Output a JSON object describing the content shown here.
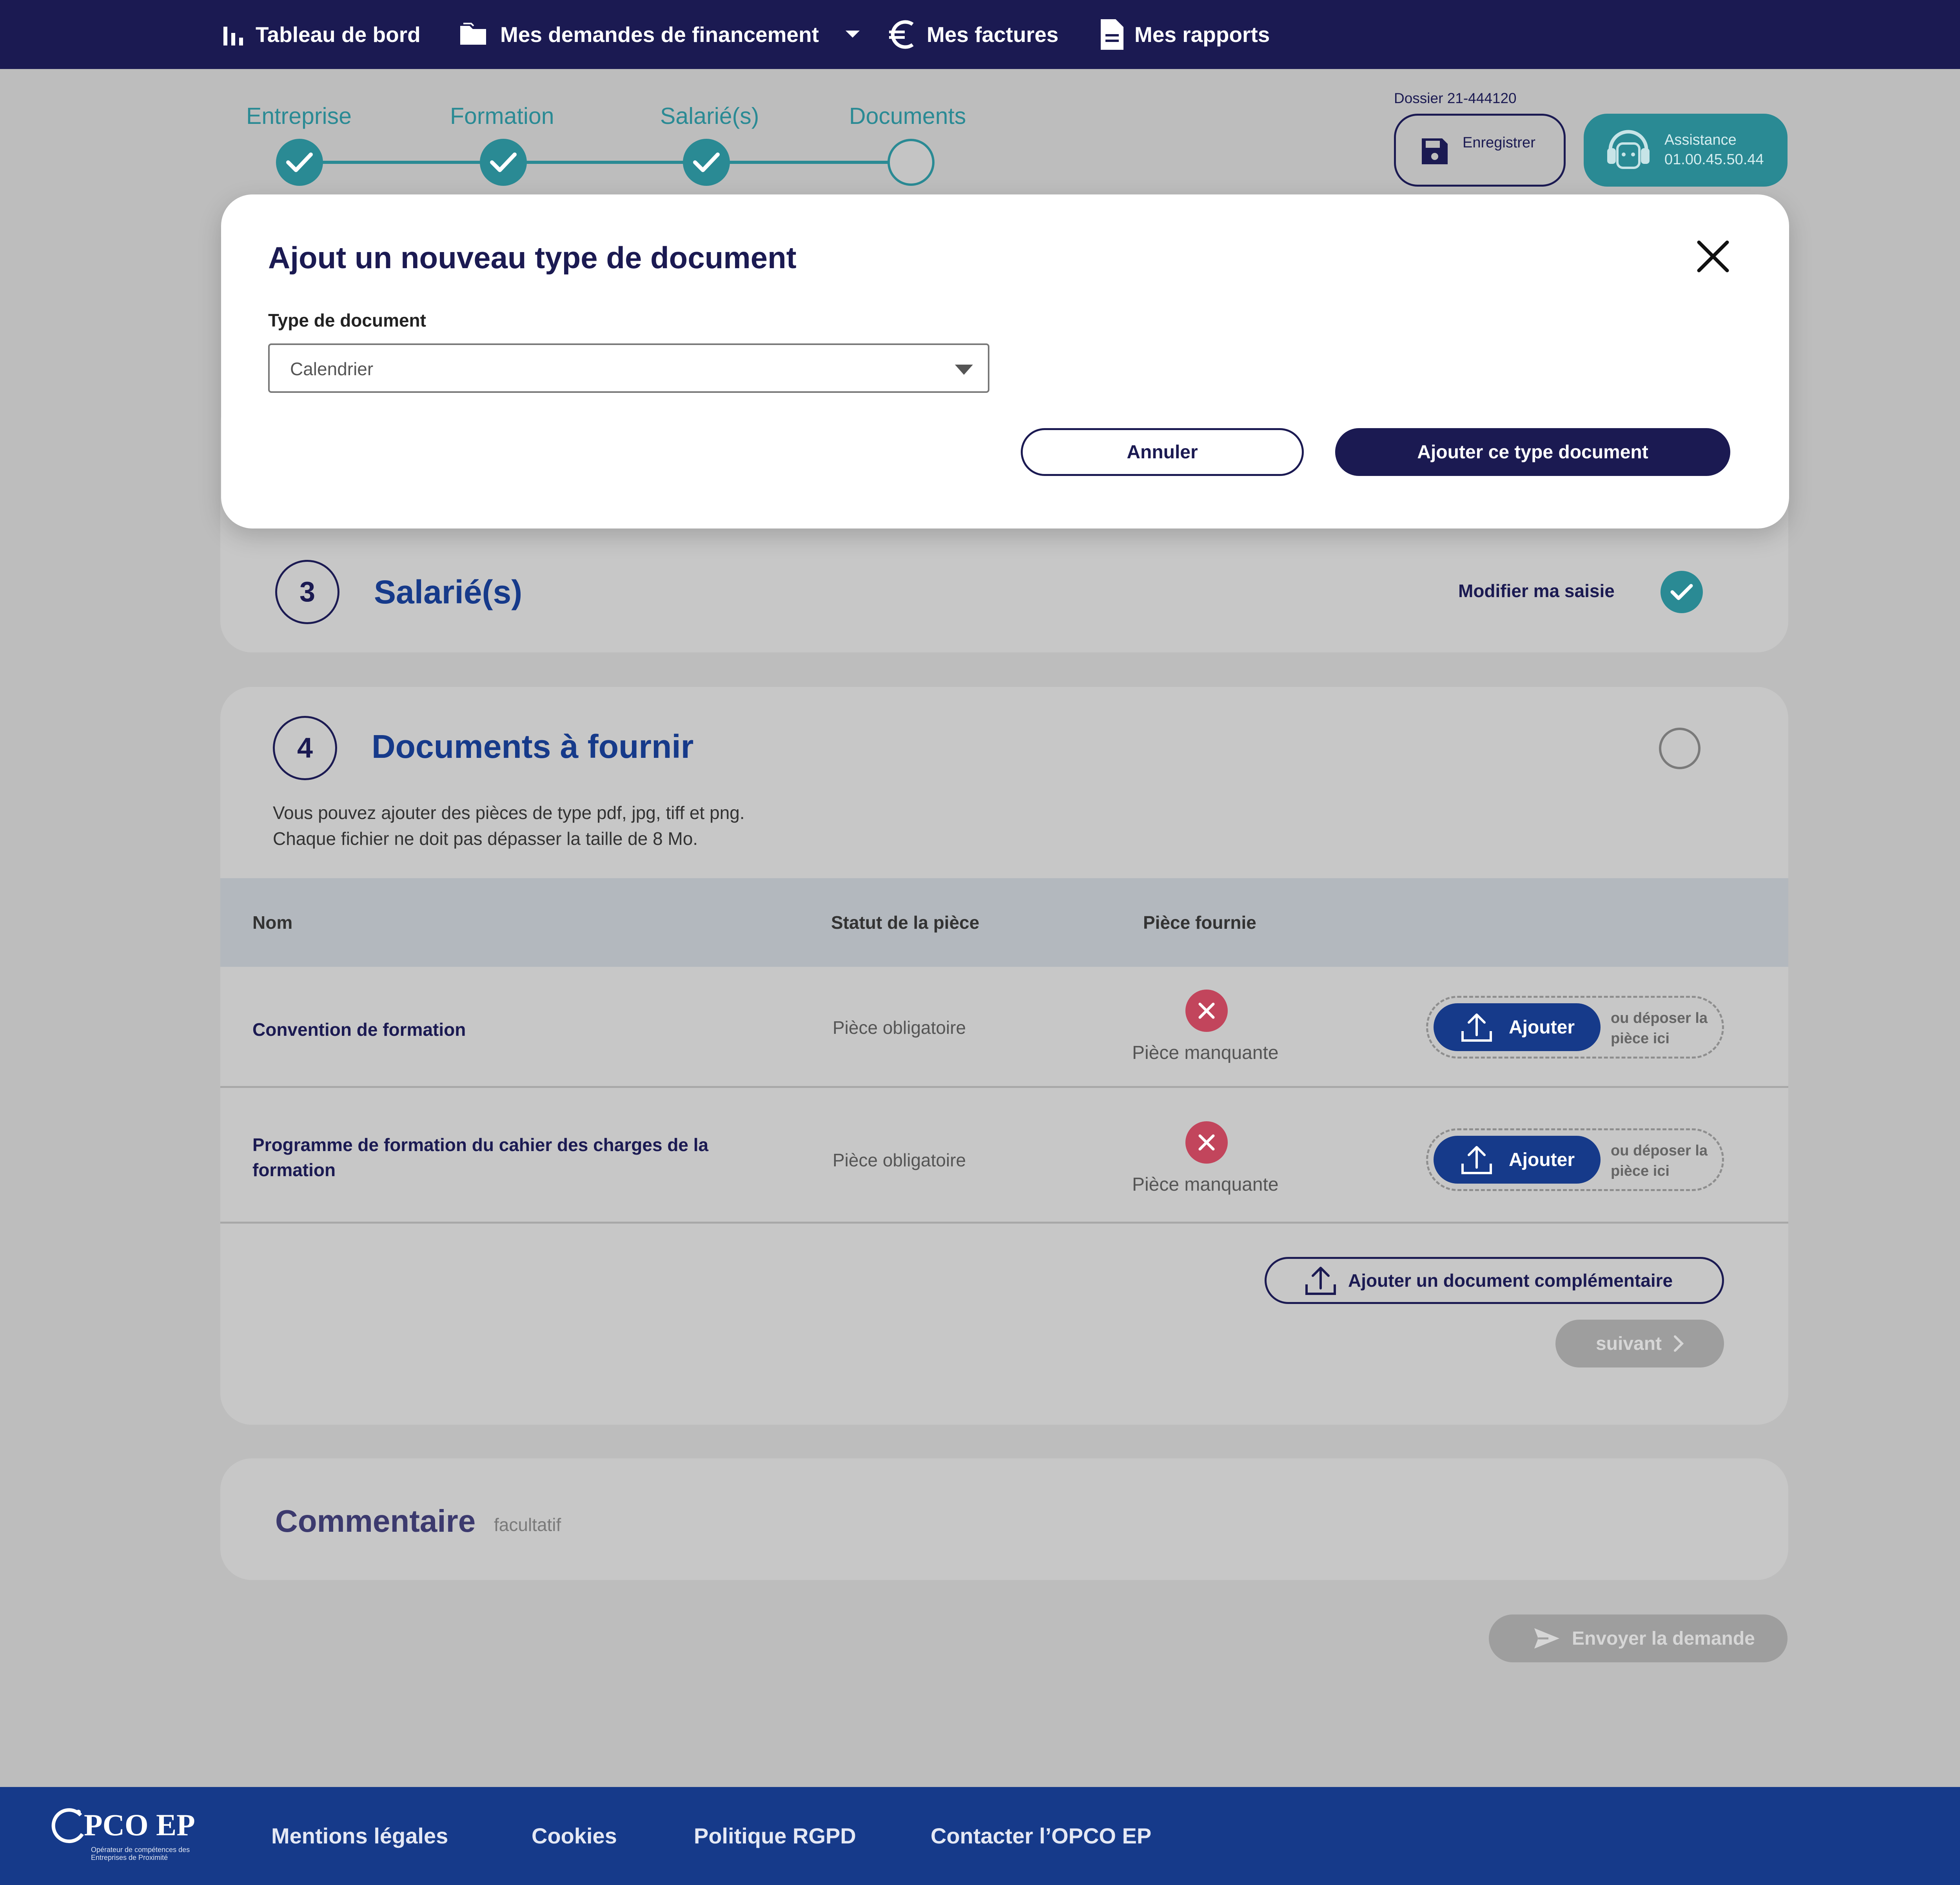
{
  "nav": {
    "items": [
      {
        "label": "Tableau de bord",
        "icon": "bar-chart-icon"
      },
      {
        "label": "Mes demandes de financement",
        "icon": "folder-icon"
      },
      {
        "label": "Mes factures",
        "icon": "euro-icon"
      },
      {
        "label": "Mes rapports",
        "icon": "document-icon"
      }
    ]
  },
  "stepper": {
    "steps": [
      {
        "label": "Entreprise",
        "done": true
      },
      {
        "label": "Formation",
        "done": true
      },
      {
        "label": "Salarié(s)",
        "done": true
      },
      {
        "label": "Documents",
        "done": false
      }
    ]
  },
  "header_actions": {
    "dossier": "Dossier 21-444120",
    "save_label": "Enregistrer",
    "assist_label": "Assistance",
    "assist_phone": "01.00.45.50.44"
  },
  "modal": {
    "title": "Ajout un nouveau type de document",
    "field_label": "Type de document",
    "selected": "Calendrier",
    "cancel": "Annuler",
    "confirm": "Ajouter ce type document"
  },
  "section3": {
    "number": "3",
    "title": "Salarié(s)",
    "edit_label": "Modifier ma saisie"
  },
  "section4": {
    "number": "4",
    "title": "Documents à fournir",
    "info_line1": "Vous pouvez ajouter des pièces de type pdf, jpg, tiff et png.",
    "info_line2": "Chaque fichier ne doit pas dépasser la taille de 8 Mo.",
    "columns": [
      "Nom",
      "Statut de la pièce",
      "Pièce fournie"
    ],
    "rows": [
      {
        "name": "Convention de formation",
        "status": "Pièce obligatoire",
        "provided": "Pièce manquante",
        "add": "Ajouter",
        "drop_hint": "ou déposer la pièce ici"
      },
      {
        "name": "Programme de formation du cahier des charges de la formation",
        "status": "Pièce obligatoire",
        "provided": "Pièce manquante",
        "add": "Ajouter",
        "drop_hint": "ou déposer la pièce ici"
      }
    ],
    "complement_label": "Ajouter un document complémentaire",
    "next_label": "suivant"
  },
  "comment": {
    "title": "Commentaire",
    "optional": "facultatif"
  },
  "send_label": "Envoyer la demande",
  "footer": {
    "logo_text": "PCO EP",
    "logo_tagline": "Opérateur de compétences des Entreprises de Proximité",
    "links": [
      "Mentions légales",
      "Cookies",
      "Politique RGPD",
      "Contacter l’OPCO EP"
    ]
  },
  "colors": {
    "navy": "#1b1a52",
    "teal": "#2a8a94",
    "blue": "#163a8a",
    "error": "#c2455c"
  }
}
